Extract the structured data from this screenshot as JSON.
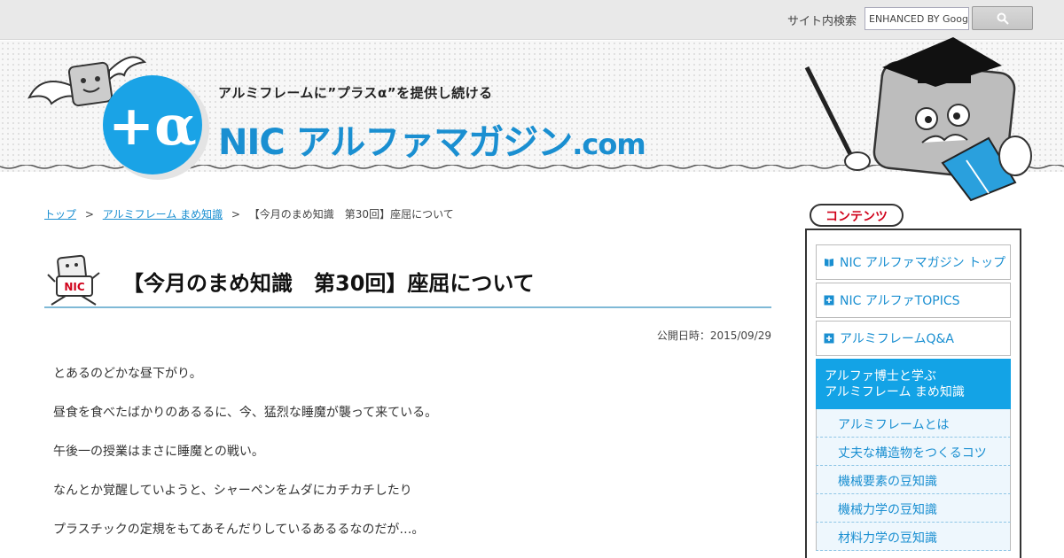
{
  "search": {
    "label": "サイト内検索",
    "placeholder": "ENHANCED BY Google",
    "button_icon": "search-icon"
  },
  "header": {
    "logo_text": "+α",
    "tagline": "アルミフレームに”プラスα”を提供し続ける",
    "site_name_main": "NIC アルファマガジン",
    "site_name_suffix": ".com"
  },
  "breadcrumb": {
    "items": [
      "トップ",
      "アルミフレーム まめ知識"
    ],
    "separator": ">",
    "current": "【今月のまめ知識　第30回】座屈について"
  },
  "article": {
    "title_icon_label": "NIC",
    "title": "【今月のまめ知識　第30回】座屈について",
    "date": "公開日時：2015/09/29",
    "paragraphs": [
      "とあるのどかな昼下がり。",
      "昼食を食べたばかりのあるるに、今、猛烈な睡魔が襲って来ている。",
      "午後一の授業はまさに睡魔との戦い。",
      "なんとか覚醒していようと、シャーペンをムダにカチカチしたり",
      "プラスチックの定規をもてあそんだりしているあるるなのだが…。"
    ]
  },
  "sidebar": {
    "title": "コンテンツ",
    "menu": [
      {
        "label": "NIC アルファマガジン トップ",
        "icon": "book-icon"
      },
      {
        "label": "NIC アルファTOPICS",
        "icon": "plus-box-icon"
      },
      {
        "label": "アルミフレームQ&A",
        "icon": "plus-box-icon"
      }
    ],
    "active_line1": "アルファ博士と学ぶ",
    "active_line2": "アルミフレーム まめ知識",
    "submenu": [
      "アルミフレームとは",
      "丈夫な構造物をつくるコツ",
      "機械要素の豆知識",
      "機械力学の豆知識",
      "材料力学の豆知識"
    ]
  },
  "colors": {
    "accent": "#1a8fd1",
    "active_bg": "#13a3e6",
    "heading_red": "#d0021b"
  }
}
